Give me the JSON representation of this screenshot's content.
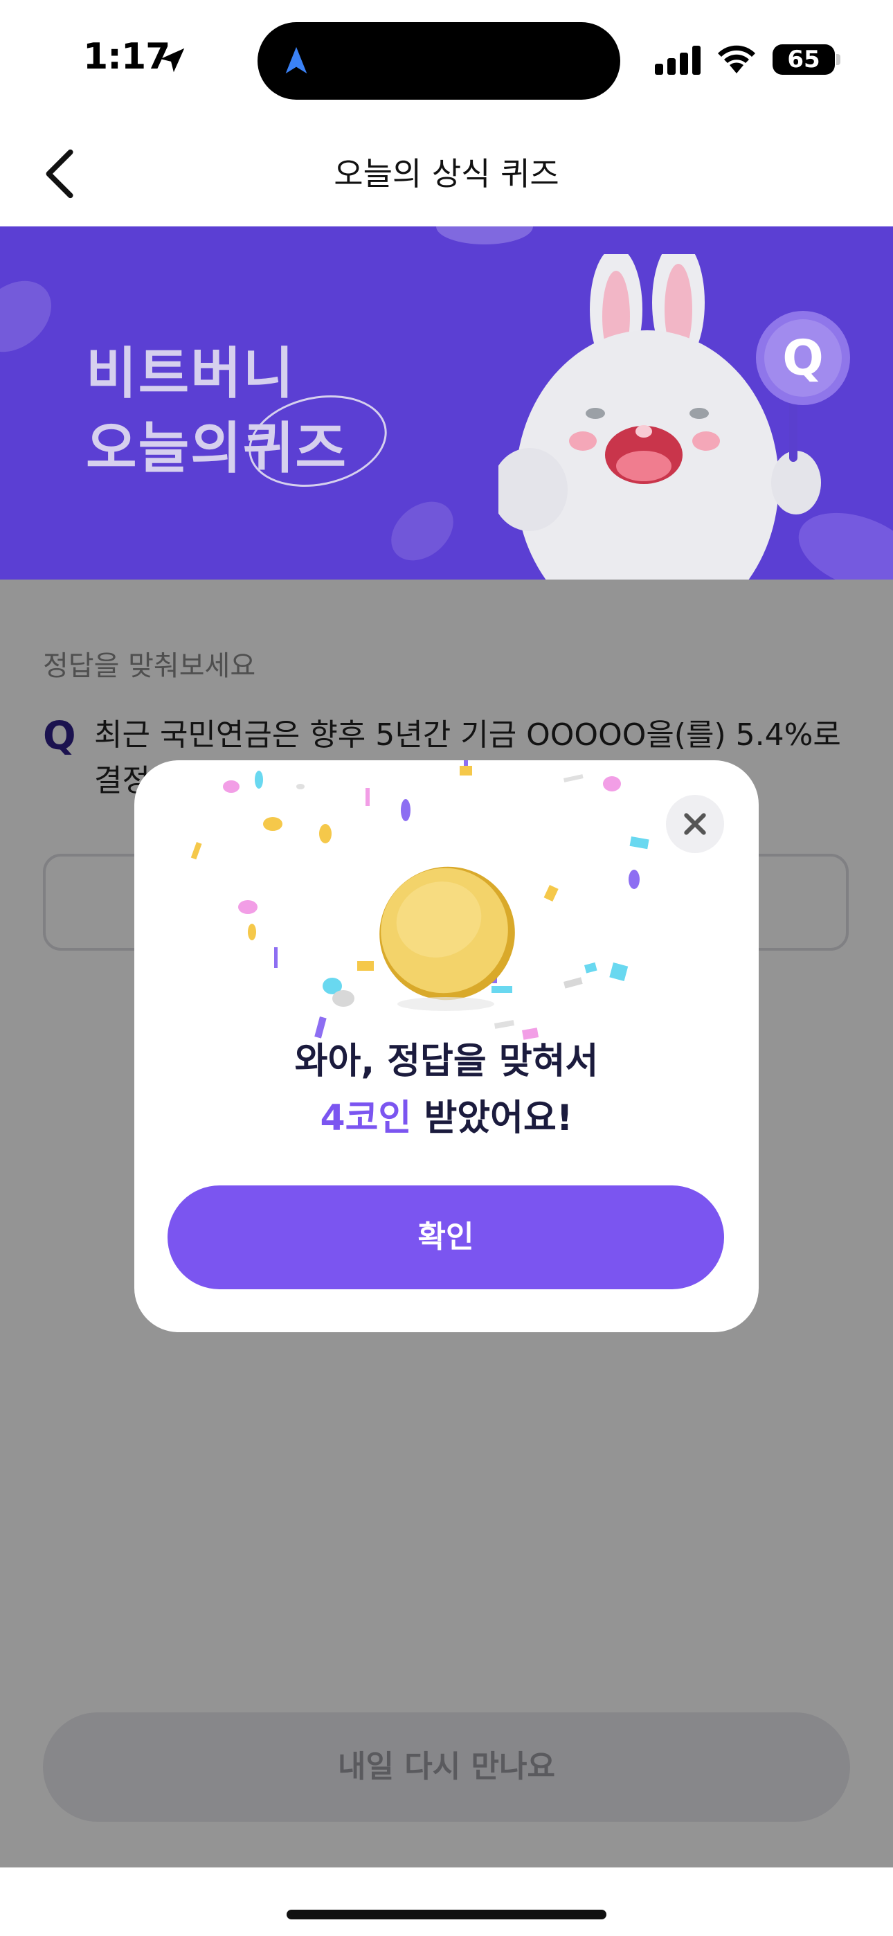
{
  "status_bar": {
    "time": "1:17",
    "battery": "65"
  },
  "header": {
    "title": "오늘의 상식 퀴즈"
  },
  "banner": {
    "line1": "비트버니",
    "line2_prefix": "오늘의",
    "line2_highlight": "퀴즈",
    "badge": "Q"
  },
  "quiz": {
    "hint": "정답을 맞춰보세요",
    "q_mark": "Q",
    "question": "최근 국민연금은 향후 5년간 기금 OOOOO을(를) 5.4%로 결정"
  },
  "bottom_button": {
    "label": "내일 다시 만나요"
  },
  "modal": {
    "line1": "와아, 정답을 맞혀서",
    "reward": "4코인",
    "line2_suffix": " 받았어요!",
    "confirm_label": "확인"
  },
  "colors": {
    "brand_purple": "#7b55f0",
    "banner_bg": "#5b3fd3",
    "title_navy": "#1b1b3d"
  }
}
